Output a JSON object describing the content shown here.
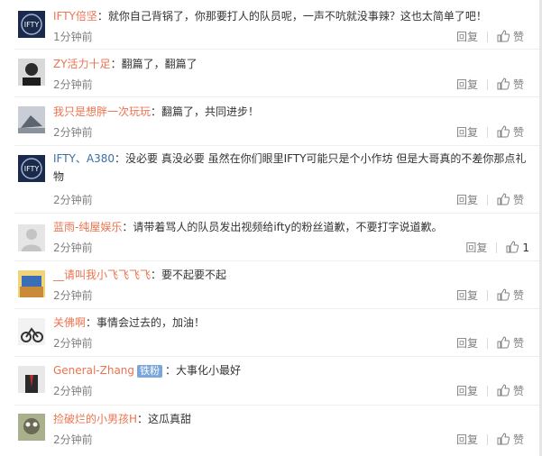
{
  "comments": [
    {
      "username": "IFTY倍坚",
      "text": "：就你自己背锅了，你那要打人的队员呢，一声不吭就没事辣？这也太简单了吧！",
      "time": "1分钟前",
      "reply_label": "回复",
      "like_label": "赞"
    },
    {
      "username": "ZY活力十足",
      "text": "：翻篇了，翻篇了",
      "time": "2分钟前",
      "reply_label": "回复",
      "like_label": "赞"
    },
    {
      "username": "我只是想胖一次玩玩",
      "text": "：翻篇了，共同进步！",
      "time": "2分钟前",
      "reply_label": "回复",
      "like_label": "赞"
    },
    {
      "username": "IFTY、A380",
      "text": "：没必要 真没必要 虽然在你们眼里IFTY可能只是个小作坊 但是大哥真的不差你那点礼物",
      "time": "2分钟前",
      "reply_label": "回复",
      "like_label": "赞"
    },
    {
      "username": "蓝雨-纯屋娱乐",
      "text": "：请带着骂人的队员发出视频给ifty的粉丝道歉，不要打字说道歉。",
      "time": "2分钟前",
      "reply_label": "回复",
      "like_label": "1"
    },
    {
      "username": "__请叫我小飞飞飞飞",
      "text": "：要不起要不起",
      "time": "2分钟前",
      "reply_label": "回复",
      "like_label": "赞"
    },
    {
      "username": "关佛啊",
      "text": "：事情会过去的，加油！",
      "time": "2分钟前",
      "reply_label": "回复",
      "like_label": "赞"
    },
    {
      "username": "General-Zhang",
      "badge": "铁粉",
      "text": "：大事化小最好",
      "time": "2分钟前",
      "reply_label": "回复",
      "like_label": "赞"
    },
    {
      "username": "捡破烂的小男孩H",
      "text": "：这瓜真甜",
      "time": "2分钟前",
      "reply_label": "回复",
      "like_label": "赞"
    }
  ],
  "colors": {
    "username": "#eb7350",
    "meta": "#808080",
    "divider": "#eeeeee",
    "badge": "#7aa6db"
  },
  "icons": {
    "like": "thumbs-up-icon",
    "avatar_logo": "ifty-logo-icon"
  }
}
